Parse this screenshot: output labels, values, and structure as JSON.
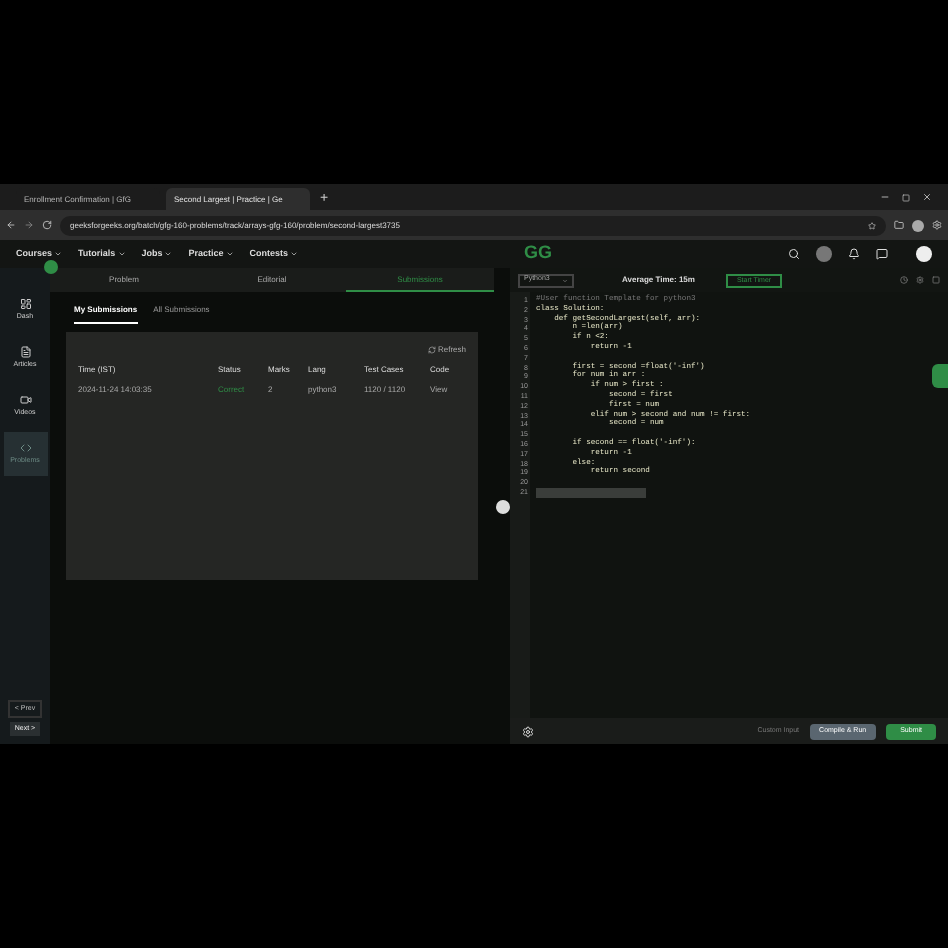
{
  "browser": {
    "tabs": [
      {
        "label": "Enrollment Confirmation | GfG",
        "selected": false
      },
      {
        "label": "Second Largest | Practice | Ge",
        "selected": true
      }
    ],
    "new_tab": "+",
    "url": "geeksforgeeks.org/batch/gfg-160-problems/track/arrays-gfg-160/problem/second-largest3735"
  },
  "nav": {
    "items": [
      "Courses",
      "Tutorials",
      "Jobs",
      "Practice",
      "Contests"
    ],
    "logo": "GG"
  },
  "sidebar": {
    "items": [
      {
        "label": "Dash",
        "selected": false
      },
      {
        "label": "Articles",
        "selected": false
      },
      {
        "label": "Videos",
        "selected": false
      },
      {
        "label": "Problems",
        "selected": true
      }
    ],
    "prev": "< Prev",
    "next": "Next >"
  },
  "panel_tabs": [
    {
      "label": "Problem",
      "selected": false
    },
    {
      "label": "Editorial",
      "selected": false
    },
    {
      "label": "Submissions",
      "selected": true
    }
  ],
  "sub_tabs": [
    {
      "label": "My Submissions",
      "selected": true
    },
    {
      "label": "All Submissions",
      "selected": false
    }
  ],
  "refresh": "Refresh",
  "table": {
    "columns": [
      "Time (IST)",
      "Status",
      "Marks",
      "Lang",
      "Test Cases",
      "Code"
    ],
    "rows": [
      [
        "2024-11-24 14:03:35",
        "Correct",
        "2",
        "python3",
        "1120 / 1120",
        "View"
      ]
    ]
  },
  "editor": {
    "language": "Python3",
    "average_time": "Average Time: 15m",
    "start_timer": "Start Timer",
    "lines": [
      {
        "number": "1",
        "kind": "comment",
        "text": "#User function Template for python3"
      },
      {
        "number": "2",
        "kind": "code",
        "text": "class Solution:"
      },
      {
        "number": "3",
        "kind": "code",
        "text": "    def getSecondLargest(self, arr):"
      },
      {
        "number": "4",
        "kind": "code",
        "text": "        n =len(arr)"
      },
      {
        "number": "5",
        "kind": "code",
        "text": "        if n <2:"
      },
      {
        "number": "6",
        "kind": "code",
        "text": "            return -1"
      },
      {
        "number": "7",
        "kind": "code"
      },
      {
        "number": "8",
        "kind": "code",
        "text": "        first = second =float('-inf')"
      },
      {
        "number": "9",
        "kind": "code",
        "text": "        for num in arr :"
      },
      {
        "number": "10",
        "kind": "code",
        "text": "            if num > first :"
      },
      {
        "number": "11",
        "kind": "code",
        "text": "                second = first"
      },
      {
        "number": "12",
        "kind": "code",
        "text": "                first = num"
      },
      {
        "number": "13",
        "kind": "code",
        "text": "            elif num > second and num != first:"
      },
      {
        "number": "14",
        "kind": "code",
        "text": "                second = num"
      },
      {
        "number": "15",
        "kind": "code"
      },
      {
        "number": "16",
        "kind": "code",
        "text": "        if second == float('-inf'):"
      },
      {
        "number": "17",
        "kind": "code",
        "text": "            return -1"
      },
      {
        "number": "18",
        "kind": "code",
        "text": "        else:"
      },
      {
        "number": "19",
        "kind": "code",
        "text": "            return second"
      },
      {
        "number": "20",
        "kind": "code"
      },
      {
        "number": "21",
        "kind": "cursor"
      }
    ],
    "custom_input": "Custom Input",
    "compile": "Compile & Run",
    "submit": "Submit"
  }
}
